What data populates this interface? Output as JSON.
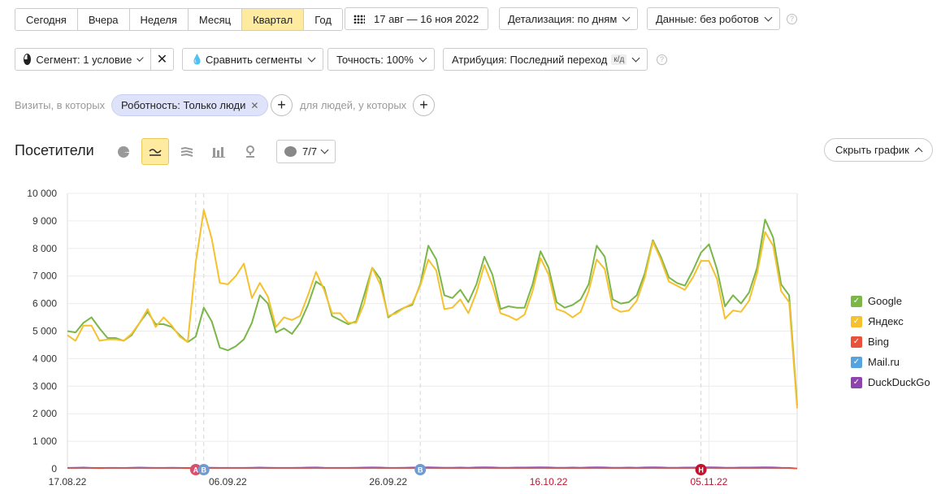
{
  "period": {
    "options": [
      "Сегодня",
      "Вчера",
      "Неделя",
      "Месяц",
      "Квартал",
      "Год"
    ],
    "active": "Квартал",
    "date_range": "17 авг — 16 ноя 2022"
  },
  "toolbar": {
    "detail": "Детализация: по дням",
    "data_filter": "Данные: без роботов",
    "segment": "Сегмент: 1 условие",
    "compare": "Сравнить сегменты",
    "accuracy": "Точность: 100%",
    "attribution": "Атрибуция: Последний переход",
    "attribution_badge": "к/д",
    "help": "?"
  },
  "filter": {
    "visits_label": "Визиты, в которых",
    "condition": "Роботность: Только люди",
    "people_label": "для людей, у которых"
  },
  "section": {
    "title": "Посетители",
    "annotations": "7/7",
    "hide_chart": "Скрыть график"
  },
  "legend": [
    {
      "name": "Google",
      "color": "#7ab648"
    },
    {
      "name": "Яндекс",
      "color": "#f5c12e"
    },
    {
      "name": "Bing",
      "color": "#e8513b"
    },
    {
      "name": "Mail.ru",
      "color": "#55a4e0"
    },
    {
      "name": "DuckDuckGo",
      "color": "#8e44ad"
    }
  ],
  "chart_data": {
    "type": "line",
    "ylim": [
      0,
      10000
    ],
    "yticks": [
      "0",
      "1 000",
      "2 000",
      "3 000",
      "4 000",
      "5 000",
      "6 000",
      "7 000",
      "8 000",
      "9 000",
      "10 000"
    ],
    "x_start": "17.08.22",
    "xticks": [
      {
        "label": "17.08.22",
        "index": 0,
        "holiday": false
      },
      {
        "label": "06.09.22",
        "index": 20,
        "holiday": false
      },
      {
        "label": "26.09.22",
        "index": 40,
        "holiday": false
      },
      {
        "label": "16.10.22",
        "index": 60,
        "holiday": true
      },
      {
        "label": "05.11.22",
        "index": 80,
        "holiday": true
      }
    ],
    "markers": [
      {
        "label": "А",
        "index": 16,
        "color": "#d9506f"
      },
      {
        "label": "В",
        "index": 17,
        "color": "#6f9bd0"
      },
      {
        "label": "В",
        "index": 44,
        "color": "#6f9bd0"
      },
      {
        "label": "Н",
        "index": 79,
        "color": "#c4122e"
      }
    ],
    "series": [
      {
        "name": "Google",
        "color": "#7ab648",
        "values": [
          5000,
          4950,
          5300,
          5500,
          5100,
          4750,
          4750,
          4650,
          4850,
          5300,
          5700,
          5250,
          5250,
          5150,
          4850,
          4600,
          4800,
          5850,
          5350,
          4400,
          4300,
          4450,
          4700,
          5300,
          6300,
          6000,
          4950,
          5100,
          4900,
          5300,
          5950,
          6800,
          6600,
          5550,
          5400,
          5250,
          5350,
          6300,
          7300,
          6900,
          5500,
          5700,
          5850,
          5950,
          6700,
          8100,
          7600,
          6300,
          6200,
          6500,
          6050,
          6700,
          7700,
          7050,
          5800,
          5900,
          5850,
          5850,
          6700,
          7900,
          7300,
          6050,
          5850,
          5950,
          6150,
          6700,
          8100,
          7700,
          6150,
          6000,
          6050,
          6300,
          7100,
          8300,
          7700,
          6950,
          6750,
          6650,
          7200,
          7850,
          8150,
          7250,
          5900,
          6300,
          6000,
          6400,
          7300,
          9050,
          8400,
          6700,
          6300,
          2300
        ]
      },
      {
        "name": "Яндекс",
        "color": "#f5c12e",
        "values": [
          4850,
          4650,
          5200,
          5200,
          4650,
          4700,
          4700,
          4650,
          4900,
          5300,
          5800,
          5150,
          5500,
          5200,
          4800,
          4600,
          7500,
          9400,
          8350,
          6750,
          6700,
          7000,
          7450,
          6200,
          6750,
          6250,
          5150,
          5500,
          5400,
          5550,
          6300,
          7150,
          6500,
          5650,
          5650,
          5300,
          5300,
          6000,
          7300,
          6700,
          5550,
          5650,
          5850,
          6000,
          6650,
          7600,
          7200,
          5800,
          5850,
          6150,
          5650,
          6400,
          7400,
          6650,
          5650,
          5550,
          5400,
          5600,
          6450,
          7650,
          7050,
          5800,
          5700,
          5500,
          5700,
          6450,
          7600,
          7250,
          5850,
          5700,
          5750,
          6100,
          6950,
          8250,
          7600,
          6800,
          6650,
          6500,
          6950,
          7550,
          7550,
          6900,
          5450,
          5750,
          5700,
          6100,
          7100,
          8600,
          8100,
          6450,
          6050,
          2200
        ]
      },
      {
        "name": "Bing",
        "color": "#e8513b",
        "values": [
          30,
          30,
          35,
          30,
          25,
          30,
          30,
          30,
          30,
          35,
          30,
          30,
          30,
          30,
          30,
          25,
          30,
          35,
          30,
          30,
          30,
          30,
          30,
          30,
          35,
          30,
          30,
          30,
          30,
          30,
          30,
          35,
          30,
          30,
          30,
          30,
          30,
          30,
          35,
          30,
          30,
          30,
          30,
          30,
          30,
          35,
          30,
          30,
          30,
          30,
          30,
          30,
          35,
          30,
          30,
          30,
          30,
          30,
          30,
          35,
          30,
          30,
          30,
          30,
          30,
          30,
          35,
          30,
          30,
          30,
          30,
          30,
          30,
          35,
          30,
          30,
          30,
          30,
          30,
          30,
          35,
          30,
          30,
          30,
          30,
          30,
          30,
          35,
          30,
          30,
          30,
          10
        ]
      },
      {
        "name": "Mail.ru",
        "color": "#55a4e0",
        "values": [
          20,
          20,
          25,
          20,
          20,
          20,
          20,
          20,
          20,
          25,
          20,
          20,
          20,
          20,
          20,
          20,
          20,
          25,
          20,
          20,
          20,
          20,
          20,
          20,
          25,
          20,
          20,
          20,
          20,
          20,
          20,
          25,
          20,
          20,
          20,
          20,
          20,
          20,
          25,
          20,
          20,
          20,
          20,
          20,
          20,
          25,
          20,
          20,
          20,
          20,
          20,
          20,
          25,
          20,
          20,
          20,
          20,
          20,
          20,
          25,
          20,
          20,
          20,
          20,
          20,
          20,
          25,
          20,
          20,
          20,
          20,
          20,
          20,
          25,
          20,
          20,
          20,
          20,
          20,
          20,
          25,
          20,
          20,
          20,
          20,
          20,
          20,
          25,
          20,
          20,
          20,
          5
        ]
      },
      {
        "name": "DuckDuckGo",
        "color": "#8e44ad",
        "values": [
          40,
          45,
          50,
          40,
          35,
          40,
          40,
          35,
          45,
          50,
          45,
          40,
          40,
          45,
          40,
          35,
          40,
          50,
          45,
          40,
          40,
          40,
          40,
          45,
          50,
          45,
          40,
          40,
          40,
          45,
          50,
          55,
          45,
          40,
          40,
          40,
          45,
          50,
          55,
          50,
          40,
          40,
          45,
          50,
          55,
          60,
          50,
          45,
          45,
          50,
          45,
          55,
          60,
          55,
          45,
          45,
          50,
          50,
          55,
          60,
          55,
          45,
          45,
          50,
          45,
          55,
          60,
          55,
          45,
          45,
          50,
          45,
          55,
          60,
          55,
          45,
          45,
          50,
          50,
          55,
          60,
          55,
          45,
          45,
          50,
          50,
          55,
          60,
          55,
          45,
          40,
          15
        ]
      }
    ]
  }
}
